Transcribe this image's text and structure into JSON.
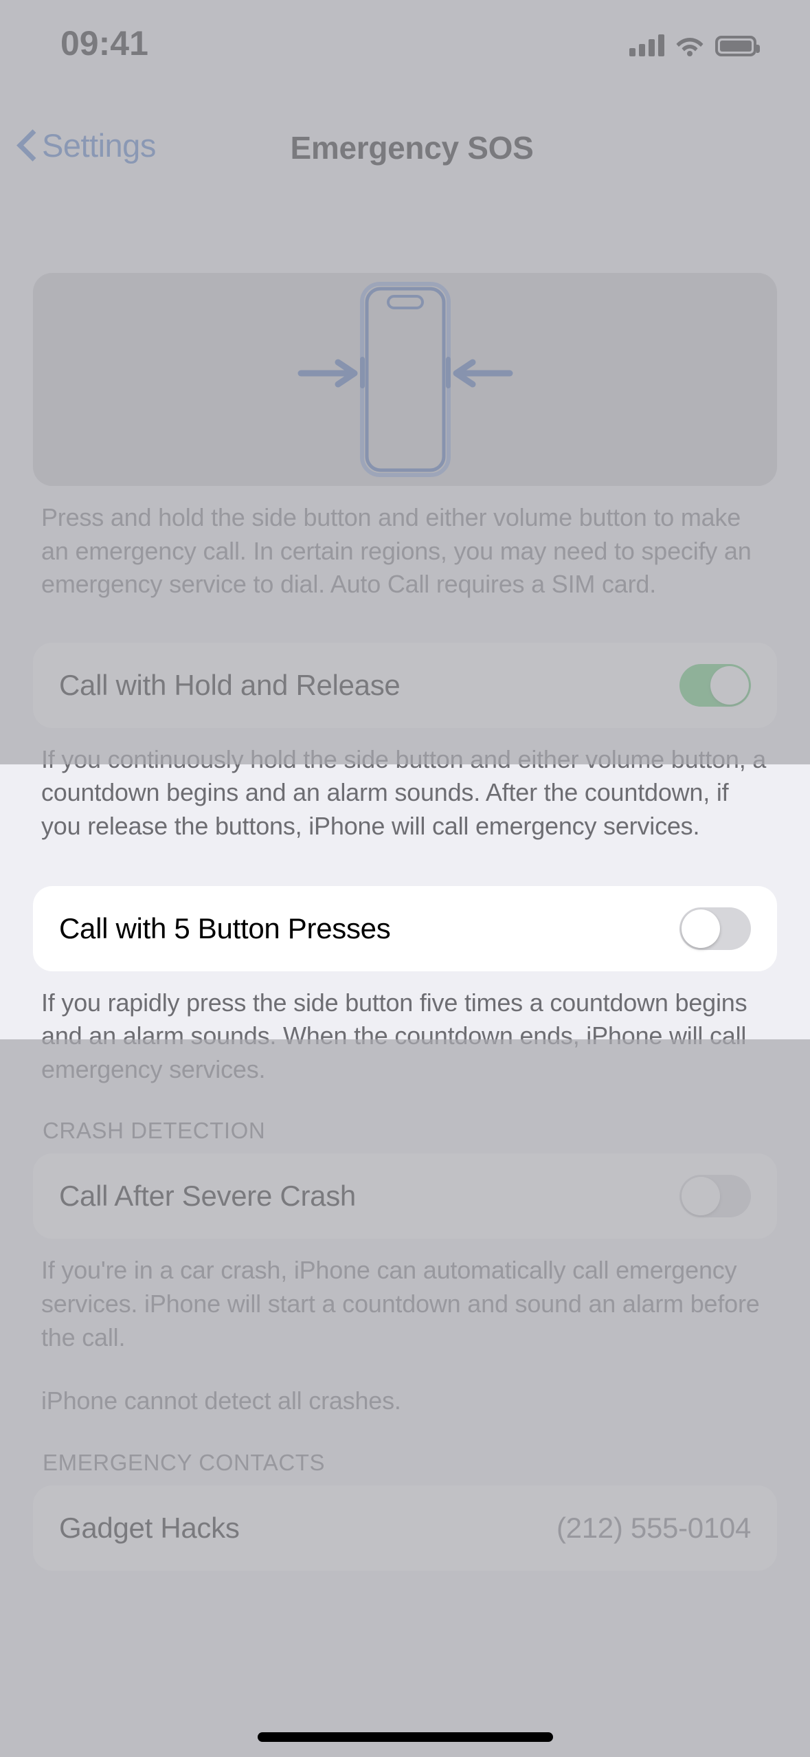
{
  "status_bar": {
    "time": "09:41",
    "icons": [
      "cellular-signal-icon",
      "wifi-icon",
      "battery-icon"
    ]
  },
  "nav": {
    "back_label": "Settings",
    "back_icon": "chevron-left-icon",
    "title": "Emergency SOS"
  },
  "hero": {
    "illustration": "iphone-side-buttons-illustration",
    "footer": "Press and hold the side button and either volume button to make an emergency call. In certain regions, you may need to specify an emergency service to dial. Auto Call requires a SIM card."
  },
  "sections": [
    {
      "id": "hold-and-release",
      "highlighted": true,
      "rows": [
        {
          "label": "Call with Hold and Release",
          "control": "toggle",
          "value": "on"
        }
      ],
      "footer": "If you continuously hold the side button and either volume button, a countdown begins and an alarm sounds. After the countdown, if you release the buttons, iPhone will call emergency services."
    },
    {
      "id": "five-button-presses",
      "highlighted": false,
      "rows": [
        {
          "label": "Call with 5 Button Presses",
          "control": "toggle",
          "value": "off"
        }
      ],
      "footer": "If you rapidly press the side button five times a countdown begins and an alarm sounds. When the countdown ends, iPhone will call emergency services."
    },
    {
      "id": "crash-detection",
      "highlighted": false,
      "header": "CRASH DETECTION",
      "rows": [
        {
          "label": "Call After Severe Crash",
          "control": "toggle",
          "value": "off"
        }
      ],
      "footer": "If you're in a car crash, iPhone can automatically call emergency services. iPhone will start a countdown and sound an alarm before the call.",
      "footer2": "iPhone cannot detect all crashes."
    },
    {
      "id": "emergency-contacts",
      "highlighted": false,
      "header": "EMERGENCY CONTACTS",
      "rows": [
        {
          "label": "Gadget Hacks",
          "control": "value",
          "value": "(212) 555-0104"
        }
      ]
    }
  ],
  "colors": {
    "accent_blue": "#3a6ec0",
    "toggle_on_green": "#4dc463",
    "toggle_off_gray": "#d6d6da",
    "dim_overlay": "#a9a9af",
    "secondary_text": "#6d6d72",
    "highlight_bg": "#efeff4",
    "card_bg": "#ffffff",
    "hero_bg": "#c9c9ce"
  }
}
